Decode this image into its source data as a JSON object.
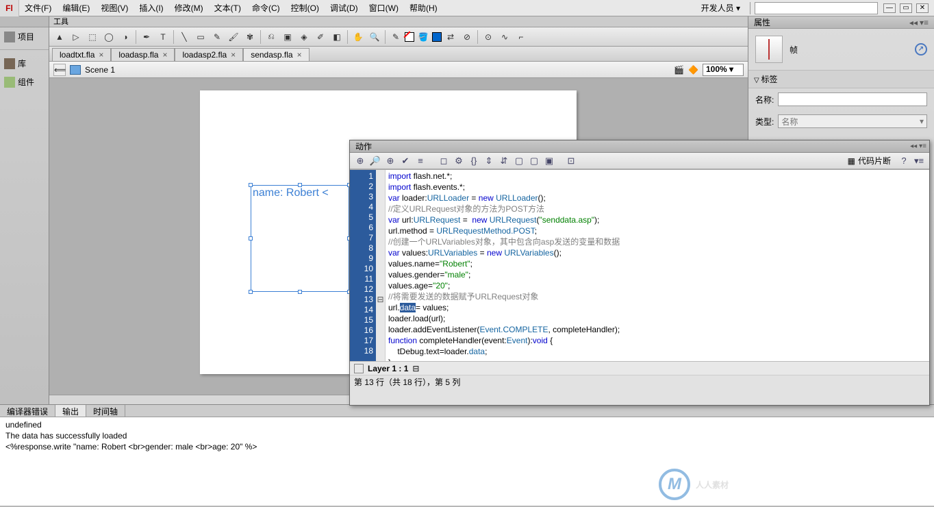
{
  "menu": {
    "items": [
      "文件(F)",
      "编辑(E)",
      "视图(V)",
      "插入(I)",
      "修改(M)",
      "文本(T)",
      "命令(C)",
      "控制(O)",
      "调试(D)",
      "窗口(W)",
      "帮助(H)"
    ],
    "dev": "开发人员",
    "search_placeholder": ""
  },
  "left_rail": {
    "items": [
      "项目",
      "库",
      "组件"
    ]
  },
  "tool_row_label": "工具",
  "doc_tabs": [
    {
      "name": "loadtxt.fla",
      "active": false
    },
    {
      "name": "loadasp.fla",
      "active": false
    },
    {
      "name": "loadasp2.fla",
      "active": false
    },
    {
      "name": "sendasp.fla",
      "active": true
    }
  ],
  "scene": {
    "label": "Scene 1",
    "zoom": "100%"
  },
  "stage_text": "name: Robert <",
  "actions": {
    "title": "动作",
    "snippet": "代码片断",
    "gutter": [
      "1",
      "2",
      "3",
      "4",
      "5",
      "6",
      "7",
      "8",
      "9",
      "10",
      "11",
      "12",
      "13",
      "14",
      "15",
      "16",
      "17",
      "18"
    ],
    "fold": [
      "",
      "",
      "",
      "",
      "",
      "",
      "",
      "",
      "",
      "",
      "",
      "",
      "⊟",
      "",
      "",
      "",
      "",
      ""
    ],
    "layer": "Layer 1 : 1",
    "status": "第 13 行（共 18 行），第 5 列"
  },
  "code": {
    "l1a": "import",
    "l1b": " flash.net.*;",
    "l2a": "import",
    "l2b": " flash.events.*;",
    "l3a": "var",
    "l3b": " loader:",
    "l3c": "URLLoader",
    "l3d": " = ",
    "l3e": "new",
    "l3f": " URLLoader",
    "l3g": "();",
    "l4": "//定义URLRequest对象的方法为POST方法",
    "l5a": "var",
    "l5b": " url:",
    "l5c": "URLRequest",
    "l5d": " =  ",
    "l5e": "new",
    "l5f": " URLRequest",
    "l5g": "(",
    "l5h": "\"senddata.asp\"",
    "l5i": ");",
    "l6a": "url.method = ",
    "l6b": "URLRequestMethod.POST",
    "l6c": ";",
    "l7": "//创建一个URLVariables对象，其中包含向asp发送的变量和数据",
    "l8a": "var",
    "l8b": " values:",
    "l8c": "URLVariables",
    "l8d": " = ",
    "l8e": "new",
    "l8f": " URLVariables",
    "l8g": "();",
    "l9a": "values.name=",
    "l9b": "\"Robert\"",
    "l9c": ";",
    "l10a": "values.gender=",
    "l10b": "\"male\"",
    "l10c": ";",
    "l11a": "values.age=",
    "l11b": "\"20\"",
    "l11c": ";",
    "l12": "//将需要发送的数据赋予URLRequest对象",
    "l13a": "url.",
    "l13b": "data",
    "l13c": "= values;",
    "l14": "loader.load(url);",
    "l15a": "loader.addEventListener(",
    "l15b": "Event.COMPLETE",
    "l15c": ", completeHandler);",
    "l16a": "function",
    "l16b": " completeHandler(event:",
    "l16c": "Event",
    "l16d": "):",
    "l16e": "void",
    "l16f": " {",
    "l17a": "    tDebug.text=loader.",
    "l17b": "data",
    "l17c": ";",
    "l18": "}"
  },
  "bottom_tabs": [
    "编译器错误",
    "输出",
    "时间轴"
  ],
  "output_lines": [
    "undefined",
    "The data has successfully loaded",
    "<%response.write \"name: Robert <br>gender: male <br>age: 20\" %>"
  ],
  "props": {
    "title": "属性",
    "frame": "帧",
    "section": "标签",
    "name_label": "名称:",
    "type_label": "类型:",
    "type_value": "名称"
  },
  "watermark": "人人素材"
}
